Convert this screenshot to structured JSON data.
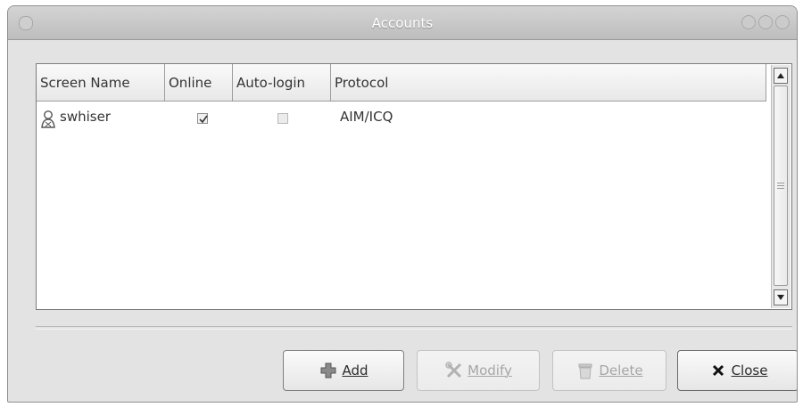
{
  "window": {
    "title": "Accounts"
  },
  "table": {
    "columns": [
      "Screen Name",
      "Online",
      "Auto-login",
      "Protocol"
    ],
    "rows": [
      {
        "screen_name": "swhiser",
        "online": true,
        "auto_login": false,
        "protocol": "AIM/ICQ"
      }
    ]
  },
  "buttons": {
    "add": "Add",
    "modify": "Modify",
    "delete": "Delete",
    "close": "Close"
  },
  "icons": {
    "add": "plus-icon",
    "modify": "tools-icon",
    "delete": "trash-icon",
    "close": "x-icon",
    "user": "user-icon"
  }
}
